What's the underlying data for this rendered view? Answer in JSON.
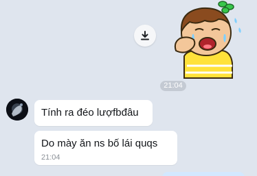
{
  "messages": [
    {
      "type": "sticker",
      "direction": "outgoing",
      "sticker_icon": "crying-boy-sticker",
      "action_icon": "download-icon",
      "time": "21:04"
    },
    {
      "type": "text",
      "direction": "incoming",
      "text": "Tính ra đéo lượfbđâu"
    },
    {
      "type": "text",
      "direction": "incoming",
      "text": "Do mày ăn ns bố lái quqs",
      "time": "21:04"
    }
  ],
  "colors": {
    "chat_background": "#dfe5ee",
    "incoming_bubble": "#ffffff",
    "outgoing_bubble": "#d3e8ff",
    "timestamp_pill": "#c4cad3",
    "sticker_shirt": "#ffe23a",
    "sticker_leaf": "#38c64b"
  }
}
